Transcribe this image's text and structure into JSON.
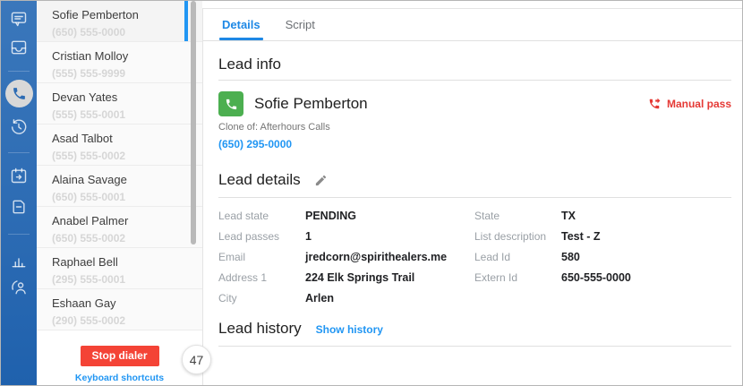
{
  "colors": {
    "rail_blue": "#2d6cb4",
    "accent_blue": "#1e88e5",
    "link_blue": "#2196f3",
    "danger_red": "#f44336",
    "manual_pass_red": "#e53935",
    "success_green": "#4caf50",
    "selected_bar_blue": "#2196f3"
  },
  "rail": {
    "icons": [
      "chat-icon",
      "inbox-icon",
      "phone-icon (active)",
      "history-icon",
      "calendar-forward-icon",
      "note-icon",
      "bar-chart-icon",
      "support-icon"
    ]
  },
  "contacts": {
    "items": [
      {
        "name": "Sofie Pemberton",
        "phone": "(650) 555-0000",
        "selected": true
      },
      {
        "name": "Cristian Molloy",
        "phone": "(555) 555-9999",
        "selected": false
      },
      {
        "name": "Devan Yates",
        "phone": "(555) 555-0001",
        "selected": false
      },
      {
        "name": "Asad Talbot",
        "phone": "(555) 555-0002",
        "selected": false
      },
      {
        "name": "Alaina Savage",
        "phone": "(650) 555-0001",
        "selected": false
      },
      {
        "name": "Anabel Palmer",
        "phone": "(650) 555-0002",
        "selected": false
      },
      {
        "name": "Raphael Bell",
        "phone": "(295) 555-0001",
        "selected": false
      },
      {
        "name": "Eshaan Gay",
        "phone": "(290) 555-0002",
        "selected": false
      }
    ],
    "stop_button_label": "Stop dialer",
    "shortcuts_label": "Keyboard shortcuts",
    "counter_badge": "47"
  },
  "main": {
    "tabs": [
      {
        "label": "Details",
        "active": true
      },
      {
        "label": "Script",
        "active": false
      }
    ],
    "lead_info": {
      "heading": "Lead info",
      "name": "Sofie Pemberton",
      "clone_of": "Clone of: Afterhours Calls",
      "phone_link": "(650) 295-0000",
      "manual_pass_label": "Manual pass"
    },
    "lead_details": {
      "heading": "Lead details",
      "left_fields": [
        {
          "label": "Lead state",
          "value": "PENDING"
        },
        {
          "label": "Lead passes",
          "value": "1"
        },
        {
          "label": "Email",
          "value": "jredcorn@spirithealers.me"
        },
        {
          "label": "Address 1",
          "value": "224 Elk Springs Trail"
        },
        {
          "label": "City",
          "value": "Arlen"
        }
      ],
      "right_fields": [
        {
          "label": "State",
          "value": "TX"
        },
        {
          "label": "List description",
          "value": "Test - Z"
        },
        {
          "label": "Lead Id",
          "value": "580"
        },
        {
          "label": "Extern Id",
          "value": "650-555-0000"
        }
      ]
    },
    "lead_history": {
      "heading": "Lead history",
      "show_history_label": "Show history"
    }
  }
}
